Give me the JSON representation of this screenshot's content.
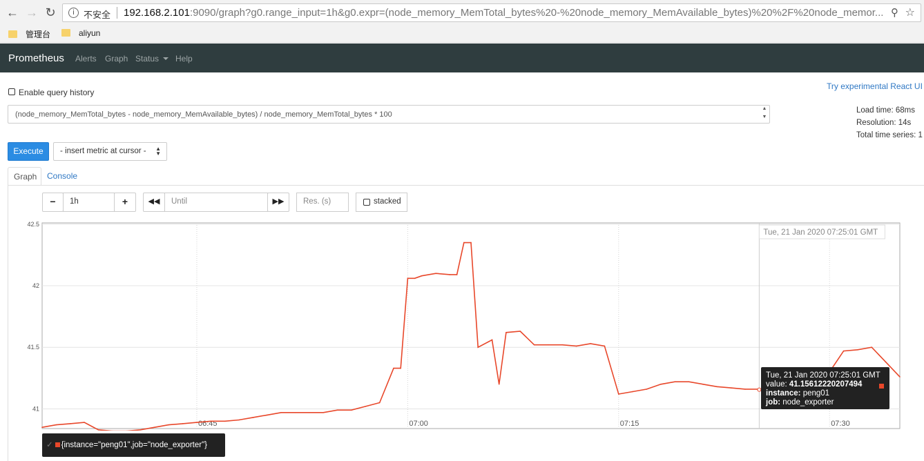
{
  "browser": {
    "security_label": "不安全",
    "url_host": "192.168.2.101",
    "url_rest": ":9090/graph?g0.range_input=1h&g0.expr=(node_memory_MemTotal_bytes%20-%20node_memory_MemAvailable_bytes)%20%2F%20node_memor...",
    "bookmarks": [
      "管理台",
      "aliyun"
    ]
  },
  "navbar": {
    "brand": "Prometheus",
    "links": [
      "Alerts",
      "Graph",
      "Status",
      "Help"
    ]
  },
  "query": {
    "history_label": "Enable query history",
    "react_link": "Try experimental React UI",
    "expression": "(node_memory_MemTotal_bytes - node_memory_MemAvailable_bytes) / node_memory_MemTotal_bytes * 100",
    "load_time": "Load time: 68ms",
    "resolution": "Resolution: 14s",
    "total_series": "Total time series: 1",
    "execute_label": "Execute",
    "metric_select": "- insert metric at cursor -"
  },
  "tabs": [
    "Graph",
    "Console"
  ],
  "controls": {
    "range": "1h",
    "until_placeholder": "Until",
    "res_placeholder": "Res. (s)",
    "stacked_label": "stacked"
  },
  "hover_time": "Tue, 21 Jan 2020 07:25:01 GMT",
  "tooltip": {
    "time": "Tue, 21 Jan 2020 07:25:01 GMT",
    "value_label": "value:",
    "value": "41.15612220207494",
    "instance_label": "instance:",
    "instance": "peng01",
    "job_label": "job:",
    "job": "node_exporter"
  },
  "legend": {
    "series": "{instance=\"peng01\",job=\"node_exporter\"}"
  },
  "colors": {
    "series": "#e8472a",
    "brand_nav": "#2f3d3f",
    "primary": "#2b8ce3"
  },
  "chart_data": {
    "type": "line",
    "x_ticks": [
      "06:45",
      "07:00",
      "07:15",
      "07:30"
    ],
    "y_ticks": [
      "41",
      "41.5",
      "42",
      "42.5"
    ],
    "ylim": [
      40.84,
      42.51
    ],
    "grid": true,
    "series": [
      {
        "name": "{instance=\"peng01\",job=\"node_exporter\"}",
        "x": [
          "06:34",
          "06:35",
          "06:36",
          "06:37",
          "06:38",
          "06:39",
          "06:40",
          "06:41",
          "06:42",
          "06:43",
          "06:44",
          "06:45",
          "06:46",
          "06:47",
          "06:48",
          "06:49",
          "06:50",
          "06:51",
          "06:52",
          "06:53",
          "06:54",
          "06:55",
          "06:56",
          "06:57",
          "06:58",
          "06:59",
          "06:59:30",
          "07:00",
          "07:00:30",
          "07:01",
          "07:02",
          "07:03",
          "07:03:30",
          "07:04",
          "07:04:30",
          "07:05",
          "07:06",
          "07:06:30",
          "07:07",
          "07:08",
          "07:09",
          "07:10",
          "07:11",
          "07:12",
          "07:13",
          "07:14",
          "07:15",
          "07:16",
          "07:17",
          "07:18",
          "07:19",
          "07:20",
          "07:21",
          "07:22",
          "07:23",
          "07:24",
          "07:25",
          "07:26",
          "07:27",
          "07:28",
          "07:29",
          "07:30",
          "07:31",
          "07:32",
          "07:33",
          "07:34",
          "07:35"
        ],
        "values": [
          40.85,
          40.87,
          40.88,
          40.89,
          40.83,
          40.82,
          40.82,
          40.83,
          40.85,
          40.87,
          40.88,
          40.89,
          40.9,
          40.9,
          40.91,
          40.93,
          40.95,
          40.97,
          40.97,
          40.97,
          40.97,
          40.99,
          40.99,
          41.02,
          41.05,
          41.33,
          41.33,
          42.06,
          42.06,
          42.08,
          42.1,
          42.09,
          42.09,
          42.35,
          42.35,
          41.5,
          41.56,
          41.2,
          41.62,
          41.63,
          41.52,
          41.52,
          41.52,
          41.51,
          41.53,
          41.51,
          41.12,
          41.14,
          41.16,
          41.2,
          41.22,
          41.22,
          41.2,
          41.18,
          41.17,
          41.16,
          41.16,
          41.15,
          41.15,
          41.15,
          41.3,
          41.3,
          41.47,
          41.48,
          41.5,
          41.38,
          41.26
        ]
      }
    ]
  }
}
